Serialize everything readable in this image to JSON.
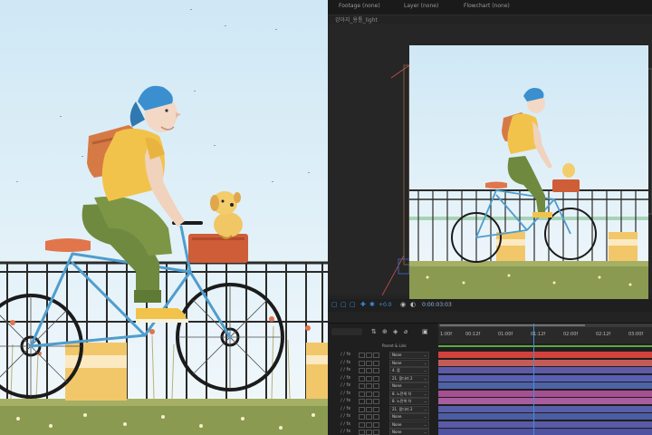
{
  "panel_tabs": [
    {
      "label": "Footage (none)"
    },
    {
      "label": "Layer (none)"
    },
    {
      "label": "Flowchart (none)"
    }
  ],
  "composition": {
    "name": "강아지_용통_light"
  },
  "viewer_toolbar": {
    "zoom": "+0.0",
    "timecode": "0:00:03:03"
  },
  "timeline": {
    "parent_header": "Parent & Link",
    "ruler_ticks": [
      "1:00f",
      "00:12f",
      "01:00f",
      "01:12f",
      "02:00f",
      "02:12f",
      "03:00f"
    ],
    "layers": [
      {
        "parent": "None",
        "color": "#d2413b"
      },
      {
        "parent": "None",
        "color": "#c55b58"
      },
      {
        "parent": "4. 몸",
        "color": "#5e5aa6"
      },
      {
        "parent": "21. 몸다리 2",
        "color": "#595fb3"
      },
      {
        "parent": "None",
        "color": "#4e62a4"
      },
      {
        "parent": "8. 노란색 하",
        "color": "#a64f93"
      },
      {
        "parent": "8. 노란색 하",
        "color": "#a95c9e"
      },
      {
        "parent": "21. 몸다리 2",
        "color": "#585ea8"
      },
      {
        "parent": "None",
        "color": "#4c5ea1"
      },
      {
        "parent": "None",
        "color": "#5a5aa6"
      },
      {
        "parent": "None",
        "color": "#4e52a0"
      }
    ]
  },
  "colors": {
    "sky_top": "#cfe8f5",
    "sky_bottom": "#edf6fb",
    "grass": "#8a9a51",
    "shirt": "#f2c34b",
    "pants": "#6f8a3e",
    "cap": "#3b8fcf",
    "backpack": "#d67a45",
    "basket": "#cf5d38",
    "frame": "#4f9dcd",
    "accent_blue": "#3b8fdc"
  },
  "icons": [
    "expand-icon",
    "grid-icon",
    "color-icon",
    "settings-icon",
    "camera-icon",
    "snapshot-icon"
  ]
}
